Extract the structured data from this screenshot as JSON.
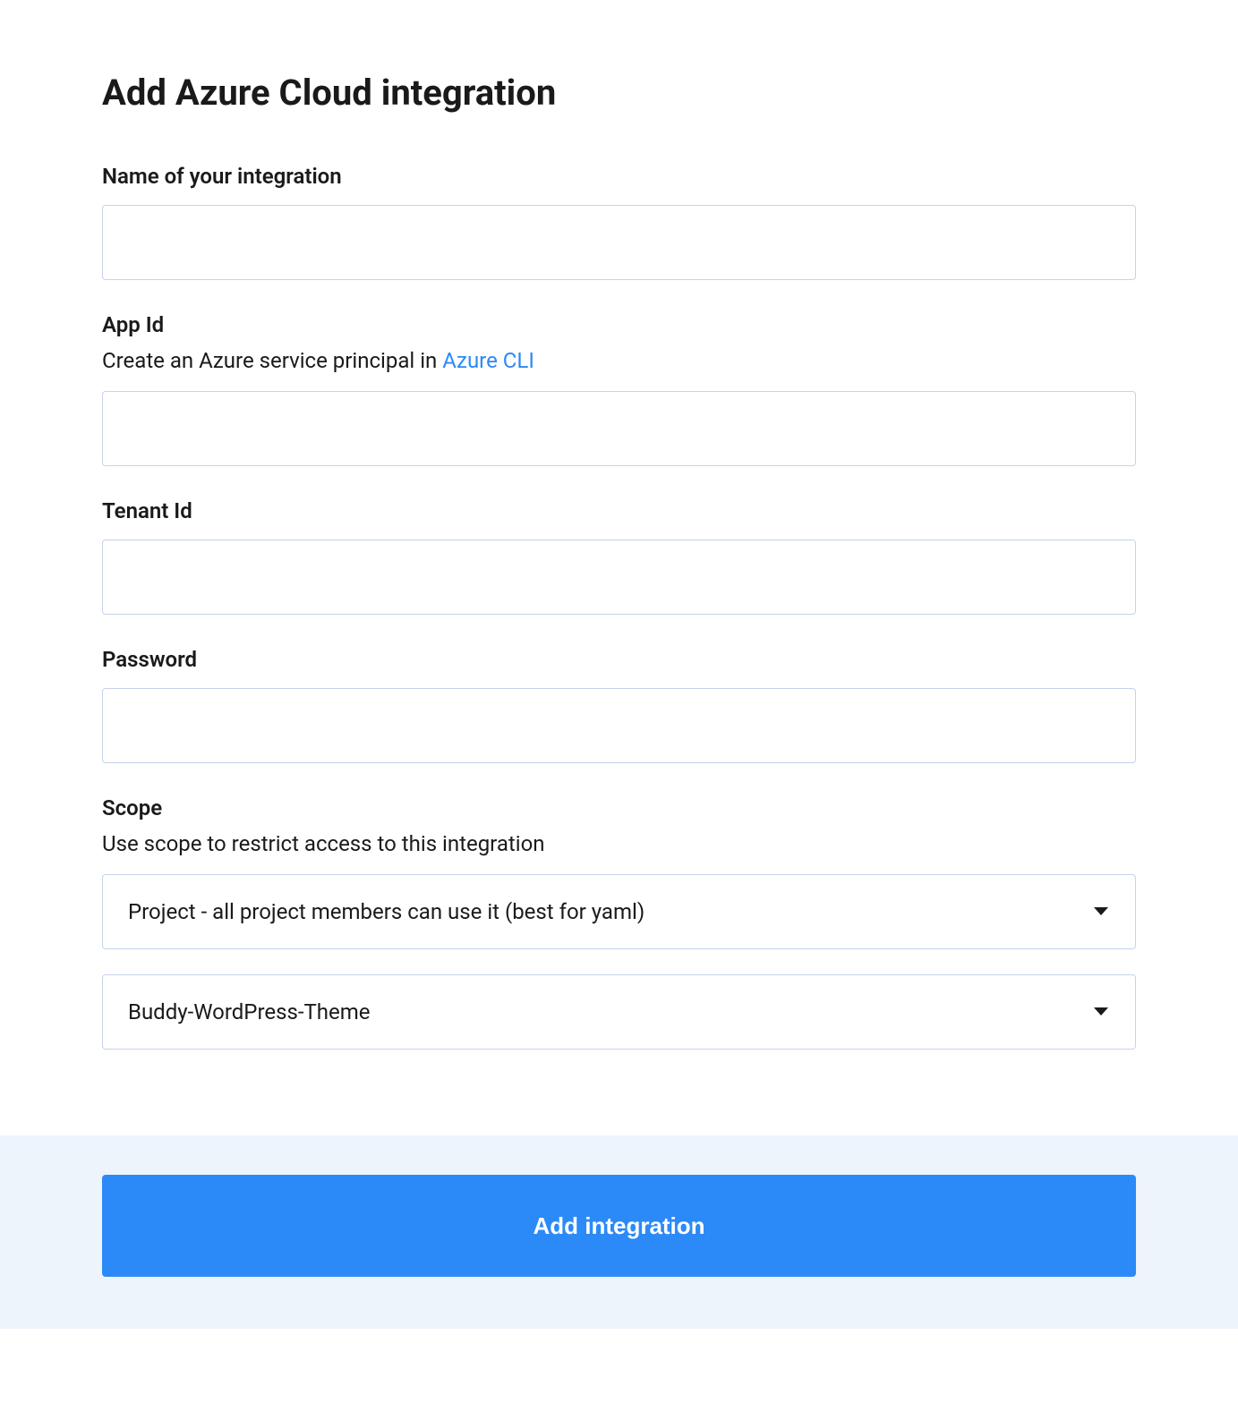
{
  "title": "Add Azure Cloud integration",
  "fields": {
    "name": {
      "label": "Name of your integration",
      "value": ""
    },
    "appId": {
      "label": "App Id",
      "descriptionPrefix": "Create an Azure service principal in ",
      "linkText": "Azure CLI",
      "value": ""
    },
    "tenantId": {
      "label": "Tenant Id",
      "value": ""
    },
    "password": {
      "label": "Password",
      "value": ""
    },
    "scope": {
      "label": "Scope",
      "description": "Use scope to restrict access to this integration",
      "select1": "Project - all project members can use it (best for yaml)",
      "select2": "Buddy-WordPress-Theme"
    }
  },
  "submitLabel": "Add integration"
}
